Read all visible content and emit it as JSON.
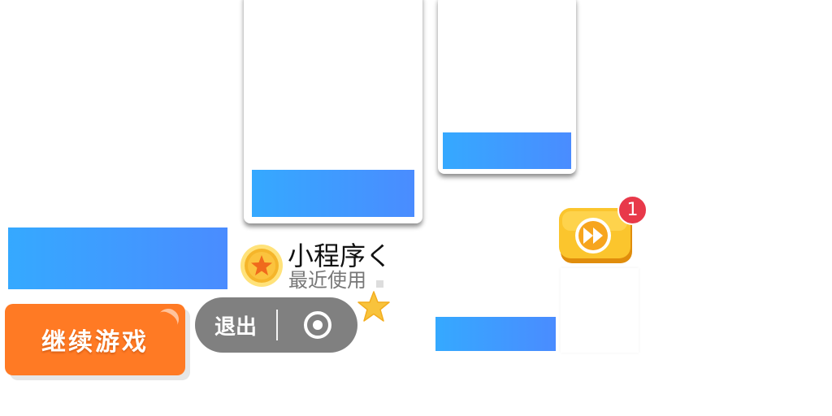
{
  "buttons": {
    "continue_label": "继续游戏",
    "exit_label": "退出"
  },
  "mini_program": {
    "title": "小程序く",
    "recent_label": "最近使用"
  },
  "fast_forward": {
    "badge_count": "1"
  },
  "icons": {
    "coin": "coin-star-icon",
    "star": "star-icon",
    "target": "target-circle-icon",
    "fast_forward": "fast-forward-icon"
  },
  "colors": {
    "accent_orange": "#ff7a24",
    "blue_gradient_start": "#35a9ff",
    "blue_gradient_end": "#4a8cff",
    "capsule_gray": "#808080",
    "badge_red": "#e8394a",
    "gold": "#f5b52a"
  }
}
